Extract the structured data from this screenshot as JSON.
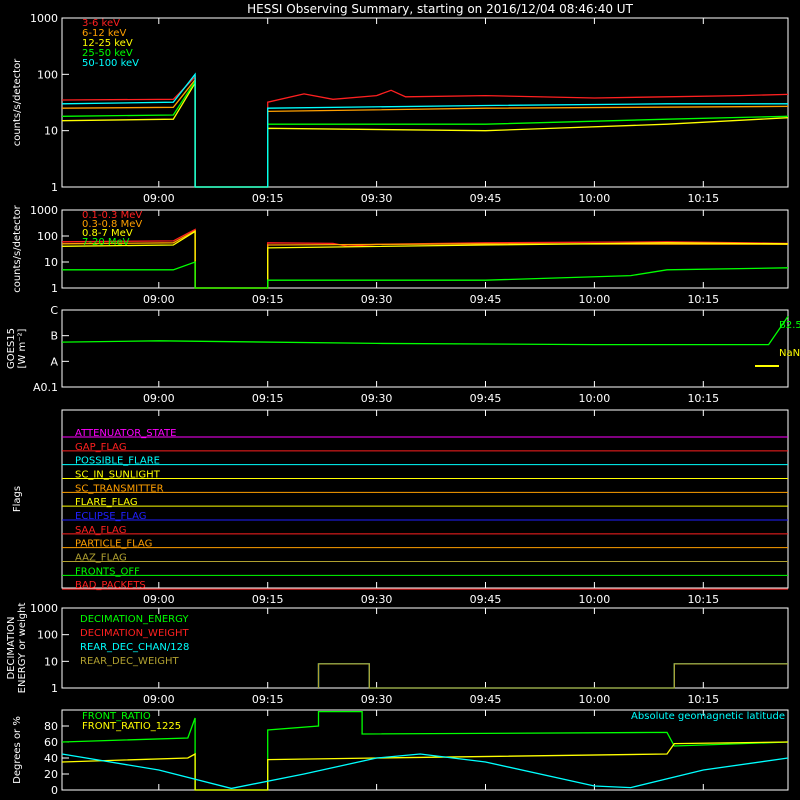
{
  "title": "HESSI Observing Summary, starting on 2016/12/04 08:46:40 UT",
  "time_ticks": [
    "09:00",
    "09:15",
    "09:30",
    "09:45",
    "10:00",
    "10:15"
  ],
  "time_range": [
    "08:46:40",
    "10:26:40"
  ],
  "colors": {
    "red": "#ff2020",
    "orange": "#ff9f00",
    "yellow": "#ffff00",
    "green": "#00ff00",
    "cyan": "#00ffff",
    "magenta": "#ff00ff",
    "blue": "#2020ff",
    "brown": "#c06000",
    "olive": "#b0a030",
    "white": "#ffffff"
  },
  "chart_data": [
    {
      "type": "line",
      "ylabel": "counts/s/detector",
      "yscale": "log",
      "ylim": [
        1,
        1000
      ],
      "ytick_labels": [
        "1",
        "10",
        "100",
        "1000"
      ],
      "legend": [
        "3-6 keV",
        "6-12 keV",
        "12-25 keV",
        "25-50 keV",
        "50-100 keV"
      ],
      "series": [
        {
          "name": "3-6 keV",
          "color": "red",
          "points": [
            [
              "08:46:40",
              35
            ],
            [
              "09:02",
              36
            ],
            [
              "09:05",
              90
            ],
            [
              "09:05",
              0
            ],
            [
              "09:15",
              0
            ],
            [
              "09:15",
              32
            ],
            [
              "09:20",
              45
            ],
            [
              "09:24",
              36
            ],
            [
              "09:30",
              42
            ],
            [
              "09:32",
              52
            ],
            [
              "09:34",
              40
            ],
            [
              "09:45",
              42
            ],
            [
              "10:00",
              38
            ],
            [
              "10:10",
              40
            ],
            [
              "10:20",
              42
            ],
            [
              "10:26:40",
              44
            ]
          ]
        },
        {
          "name": "6-12 keV",
          "color": "orange",
          "points": [
            [
              "08:46:40",
              25
            ],
            [
              "09:02",
              26
            ],
            [
              "09:05",
              80
            ],
            [
              "09:05",
              0
            ],
            [
              "09:15",
              0
            ],
            [
              "09:15",
              22
            ],
            [
              "09:45",
              25
            ],
            [
              "10:26:40",
              27
            ]
          ]
        },
        {
          "name": "12-25 keV",
          "color": "yellow",
          "points": [
            [
              "08:46:40",
              15
            ],
            [
              "09:02",
              16
            ],
            [
              "09:05",
              70
            ],
            [
              "09:05",
              0
            ],
            [
              "09:15",
              0
            ],
            [
              "09:15",
              11
            ],
            [
              "09:45",
              10
            ],
            [
              "10:10",
              13
            ],
            [
              "10:26:40",
              17
            ]
          ]
        },
        {
          "name": "25-50 keV",
          "color": "green",
          "points": [
            [
              "08:46:40",
              18
            ],
            [
              "09:02",
              19
            ],
            [
              "09:05",
              75
            ],
            [
              "09:05",
              0
            ],
            [
              "09:15",
              0
            ],
            [
              "09:15",
              13
            ],
            [
              "09:45",
              13
            ],
            [
              "10:10",
              16
            ],
            [
              "10:26:40",
              18
            ]
          ]
        },
        {
          "name": "50-100 keV",
          "color": "cyan",
          "points": [
            [
              "08:46:40",
              30
            ],
            [
              "09:02",
              32
            ],
            [
              "09:05",
              100
            ],
            [
              "09:05",
              1
            ],
            [
              "09:15",
              1
            ],
            [
              "09:15",
              25
            ],
            [
              "09:45",
              28
            ],
            [
              "10:10",
              30
            ],
            [
              "10:26:40",
              30
            ]
          ]
        }
      ]
    },
    {
      "type": "line",
      "ylabel": "counts/s/detector",
      "yscale": "log",
      "ylim": [
        1,
        1000
      ],
      "ytick_labels": [
        "1",
        "10",
        "100",
        "1000"
      ],
      "legend": [
        "0.1-0.3 MeV",
        "0.3-0.8 MeV",
        "0.8-7 MeV",
        "7-20 MeV"
      ],
      "series": [
        {
          "name": "0.1-0.3 MeV",
          "color": "red",
          "points": [
            [
              "08:46:40",
              60
            ],
            [
              "09:02",
              65
            ],
            [
              "09:05",
              180
            ],
            [
              "09:05",
              1
            ],
            [
              "09:15",
              1
            ],
            [
              "09:15",
              55
            ],
            [
              "09:24",
              52
            ],
            [
              "09:26",
              40
            ],
            [
              "09:30",
              48
            ],
            [
              "09:45",
              55
            ],
            [
              "10:00",
              58
            ],
            [
              "10:10",
              60
            ],
            [
              "10:26:40",
              52
            ]
          ]
        },
        {
          "name": "0.3-0.8 MeV",
          "color": "orange",
          "points": [
            [
              "08:46:40",
              50
            ],
            [
              "09:02",
              55
            ],
            [
              "09:05",
              160
            ],
            [
              "09:05",
              1
            ],
            [
              "09:15",
              1
            ],
            [
              "09:15",
              45
            ],
            [
              "09:45",
              50
            ],
            [
              "10:26:40",
              48
            ]
          ]
        },
        {
          "name": "0.8-7 MeV",
          "color": "yellow",
          "points": [
            [
              "08:46:40",
              40
            ],
            [
              "09:02",
              45
            ],
            [
              "09:05",
              150
            ],
            [
              "09:05",
              1
            ],
            [
              "09:15",
              1
            ],
            [
              "09:15",
              35
            ],
            [
              "09:45",
              45
            ],
            [
              "10:10",
              55
            ],
            [
              "10:26:40",
              50
            ]
          ]
        },
        {
          "name": "7-20 MeV",
          "color": "green",
          "points": [
            [
              "08:46:40",
              5
            ],
            [
              "09:02",
              5
            ],
            [
              "09:05",
              10
            ],
            [
              "09:05",
              1
            ],
            [
              "09:15",
              1
            ],
            [
              "09:15",
              2
            ],
            [
              "09:45",
              2
            ],
            [
              "10:05",
              3
            ],
            [
              "10:10",
              5
            ],
            [
              "10:26:40",
              6
            ]
          ]
        }
      ]
    },
    {
      "type": "line",
      "ylabel": "GOES15",
      "ylabel2": "[W m⁻²]",
      "yscale": "log",
      "ytick_labels": [
        "A0.1",
        "A",
        "B",
        "C"
      ],
      "series": [
        {
          "name": "GOES long",
          "color": "green",
          "points": [
            [
              "08:46:40",
              7.5
            ],
            [
              "09:00",
              7.6
            ],
            [
              "09:30",
              7.4
            ],
            [
              "10:00",
              7.3
            ],
            [
              "10:24",
              7.3
            ],
            [
              "10:26:40",
              9.5
            ]
          ]
        }
      ],
      "annotations": [
        "B2.5",
        "NaN"
      ]
    },
    {
      "type": "flags",
      "ylabel": "Flags",
      "flags": [
        {
          "name": "ATTENUATOR_STATE",
          "color": "magenta"
        },
        {
          "name": "GAP_FLAG",
          "color": "red"
        },
        {
          "name": "POSSIBLE_FLARE",
          "color": "cyan"
        },
        {
          "name": "SC_IN_SUNLIGHT",
          "color": "yellow"
        },
        {
          "name": "SC_TRANSMITTER",
          "color": "orange"
        },
        {
          "name": "FLARE_FLAG",
          "color": "yellow"
        },
        {
          "name": "ECLIPSE_FLAG",
          "color": "blue"
        },
        {
          "name": "SAA_FLAG",
          "color": "red"
        },
        {
          "name": "PARTICLE_FLAG",
          "color": "orange"
        },
        {
          "name": "AAZ_FLAG",
          "color": "olive"
        },
        {
          "name": "FRONTS_OFF",
          "color": "green"
        },
        {
          "name": "BAD_PACKETS",
          "color": "red"
        }
      ]
    },
    {
      "type": "line",
      "ylabel": "DECIMATION",
      "ylabel2": "ENERGY or weight",
      "yscale": "log",
      "ylim": [
        1,
        1000
      ],
      "ytick_labels": [
        "1",
        "10",
        "100",
        "1000"
      ],
      "legend": [
        "DECIMATION_ENERGY",
        "DECIMATION_WEIGHT",
        "REAR_DEC_CHAN/128",
        "REAR_DEC_WEIGHT"
      ],
      "series": [
        {
          "name": "REAR_DEC_CHAN/128",
          "color": "cyan",
          "points": [
            [
              "09:22",
              1
            ],
            [
              "09:22",
              8
            ],
            [
              "09:29",
              8
            ],
            [
              "09:29",
              1
            ],
            [
              "10:11",
              1
            ],
            [
              "10:11",
              8
            ],
            [
              "10:26:40",
              8
            ]
          ]
        },
        {
          "name": "REAR_DEC_WEIGHT",
          "color": "olive",
          "points": [
            [
              "09:22",
              1
            ],
            [
              "09:22",
              8
            ],
            [
              "09:29",
              8
            ],
            [
              "09:29",
              1
            ],
            [
              "10:11",
              1
            ],
            [
              "10:11",
              8
            ],
            [
              "10:26:40",
              8
            ]
          ]
        }
      ]
    },
    {
      "type": "line",
      "ylabel": "Degrees or %",
      "ylim": [
        0,
        100
      ],
      "ytick_labels": [
        "0",
        "20",
        "40",
        "60",
        "80"
      ],
      "legend": [
        "FRONT_RATIO",
        "FRONT_RATIO_1225",
        "Absolute geomagnetic latitude"
      ],
      "series": [
        {
          "name": "FRONT_RATIO",
          "color": "green",
          "points": [
            [
              "08:46:40",
              60
            ],
            [
              "09:04",
              65
            ],
            [
              "09:05",
              90
            ],
            [
              "09:05",
              0
            ],
            [
              "09:15",
              0
            ],
            [
              "09:15",
              75
            ],
            [
              "09:22",
              80
            ],
            [
              "09:22",
              98
            ],
            [
              "09:28",
              98
            ],
            [
              "09:28",
              70
            ],
            [
              "10:10",
              72
            ],
            [
              "10:11",
              55
            ],
            [
              "10:26:40",
              60
            ]
          ]
        },
        {
          "name": "FRONT_RATIO_1225",
          "color": "yellow",
          "points": [
            [
              "08:46:40",
              35
            ],
            [
              "09:04",
              40
            ],
            [
              "09:05",
              45
            ],
            [
              "09:05",
              0
            ],
            [
              "09:15",
              0
            ],
            [
              "09:15",
              38
            ],
            [
              "09:30",
              40
            ],
            [
              "10:10",
              45
            ],
            [
              "10:11",
              58
            ],
            [
              "10:26:40",
              60
            ]
          ]
        },
        {
          "name": "Absolute geomagnetic latitude",
          "color": "cyan",
          "points": [
            [
              "08:46:40",
              45
            ],
            [
              "09:00",
              25
            ],
            [
              "09:10",
              2
            ],
            [
              "09:20",
              20
            ],
            [
              "09:30",
              40
            ],
            [
              "09:36",
              45
            ],
            [
              "09:45",
              35
            ],
            [
              "10:00",
              5
            ],
            [
              "10:05",
              3
            ],
            [
              "10:15",
              25
            ],
            [
              "10:26:40",
              40
            ]
          ]
        }
      ]
    }
  ]
}
